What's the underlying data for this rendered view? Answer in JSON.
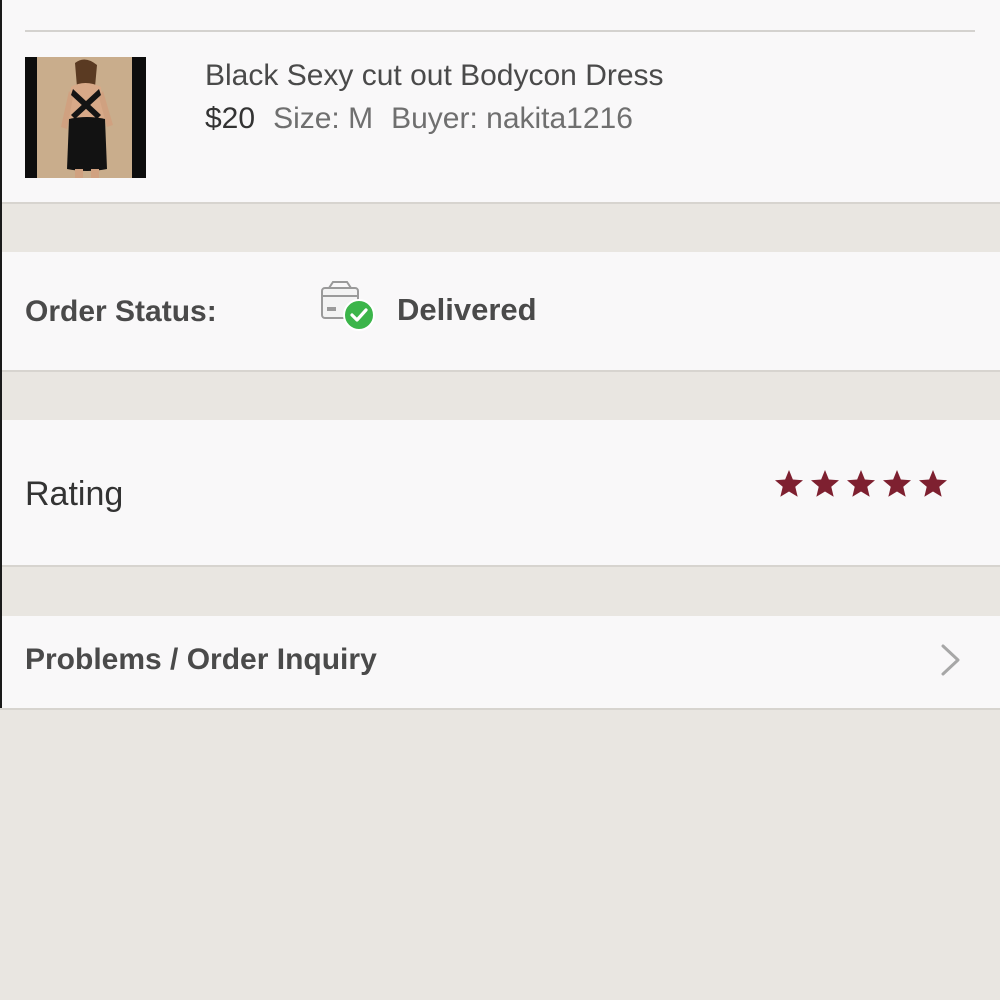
{
  "product": {
    "title": "Black Sexy cut out Bodycon Dress",
    "price": "$20",
    "size": "Size: M",
    "buyer": "Buyer: nakita1216",
    "thumbnail_icon": "dress-photo"
  },
  "order_status": {
    "label": "Order Status:",
    "value": "Delivered",
    "icon": "delivered-package-icon",
    "check_color": "#3bb54a"
  },
  "rating": {
    "label": "Rating",
    "stars": 5,
    "max_stars": 5,
    "star_color": "#7e2030"
  },
  "problems": {
    "label": "Problems / Order Inquiry",
    "icon": "chevron-right-icon"
  },
  "colors": {
    "background": "#e9e6e1",
    "card": "#f9f8f9",
    "text": "#4a4a4a"
  }
}
